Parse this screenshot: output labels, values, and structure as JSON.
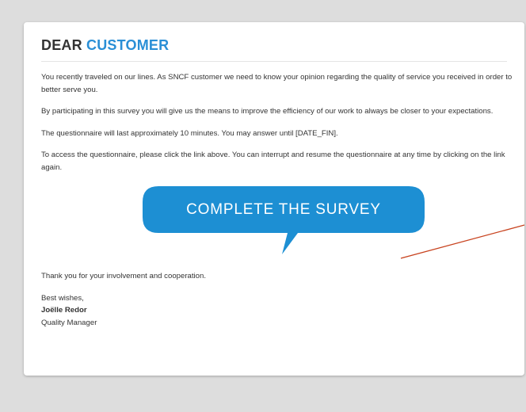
{
  "email": {
    "greeting": "DEAR",
    "greeting_accent": "CUSTOMER",
    "paragraphs": [
      "You recently traveled on our lines. As SNCF customer we need to know your opinion regarding the quality of service you received in order to better serve you.",
      "By participating in this survey you will give us the means to improve the efficiency of our work to always be closer to your expectations.",
      "The questionnaire will last approximately 10 minutes. You may answer until [DATE_FIN].",
      "To access the questionnaire, please click the link above. You can interrupt and resume the questionnaire at any time by clicking on the link again."
    ],
    "cta_label": "COMPLETE THE SURVEY",
    "thanks": "Thank you for your involvement and cooperation.",
    "closing": "Best wishes,",
    "signer_name": "Joëlle Redor",
    "signer_title": "Quality Manager"
  },
  "colors": {
    "accent": "#2a8fd6",
    "button": "#1d8fd3",
    "annotation_arrow": "#c8431f"
  }
}
